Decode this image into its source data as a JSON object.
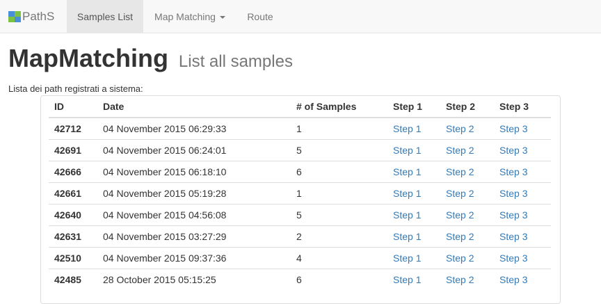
{
  "navbar": {
    "brand": "PathS",
    "items": [
      {
        "label": "Samples List",
        "active": true
      },
      {
        "label": "Map Matching",
        "dropdown": true
      },
      {
        "label": "Route"
      }
    ]
  },
  "page": {
    "title": "MapMatching",
    "title_small": "List all samples",
    "subtitle": "Lista dei path registrati a sistema:"
  },
  "table": {
    "headers": [
      "ID",
      "Date",
      "# of Samples",
      "Step 1",
      "Step 2",
      "Step 3"
    ],
    "rows": [
      {
        "id": "42712",
        "date": "04 November 2015 06:29:33",
        "samples": "1",
        "step1": "Step 1",
        "step2": "Step 2",
        "step3": "Step 3"
      },
      {
        "id": "42691",
        "date": "04 November 2015 06:24:01",
        "samples": "5",
        "step1": "Step 1",
        "step2": "Step 2",
        "step3": "Step 3"
      },
      {
        "id": "42666",
        "date": "04 November 2015 06:18:10",
        "samples": "6",
        "step1": "Step 1",
        "step2": "Step 2",
        "step3": "Step 3"
      },
      {
        "id": "42661",
        "date": "04 November 2015 05:19:28",
        "samples": "1",
        "step1": "Step 1",
        "step2": "Step 2",
        "step3": "Step 3"
      },
      {
        "id": "42640",
        "date": "04 November 2015 04:56:08",
        "samples": "5",
        "step1": "Step 1",
        "step2": "Step 2",
        "step3": "Step 3"
      },
      {
        "id": "42631",
        "date": "04 November 2015 03:27:29",
        "samples": "2",
        "step1": "Step 1",
        "step2": "Step 2",
        "step3": "Step 3"
      },
      {
        "id": "42510",
        "date": "04 November 2015 09:37:36",
        "samples": "4",
        "step1": "Step 1",
        "step2": "Step 2",
        "step3": "Step 3"
      },
      {
        "id": "42485",
        "date": "28 October 2015 05:15:25",
        "samples": "6",
        "step1": "Step 1",
        "step2": "Step 2",
        "step3": "Step 3"
      }
    ]
  },
  "colors": {
    "link": "#337ab7",
    "navbar_bg": "#f8f8f8",
    "nav_active_bg": "#e7e7e7",
    "muted_text": "#777777"
  }
}
